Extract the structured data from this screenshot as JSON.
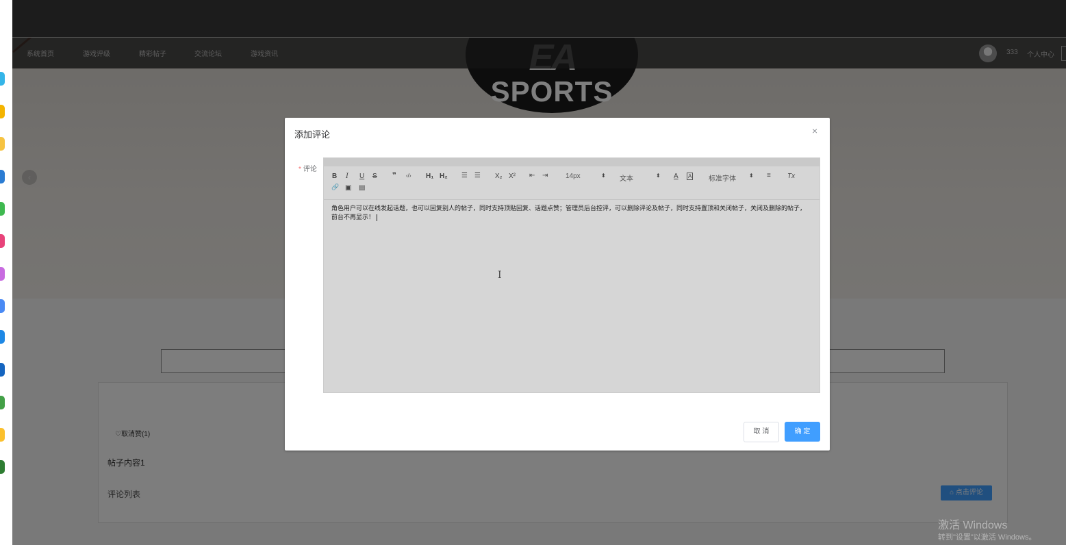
{
  "nav": {
    "items": [
      {
        "label": "系统首页"
      },
      {
        "label": "游戏评级"
      },
      {
        "label": "精彩帖子"
      },
      {
        "label": "交流论坛"
      },
      {
        "label": "游戏资讯"
      }
    ],
    "username": "333",
    "user_center": "个人中心"
  },
  "hero": {
    "logo_ea": "EA",
    "logo_sports": "SPORTS",
    "arrow": "‹"
  },
  "post": {
    "like_label": "♡取消赞(1)",
    "content": "帖子内容1",
    "comment_list_title": "评论列表",
    "comment_button": "⌂ 点击评论"
  },
  "dialog": {
    "title": "添加评论",
    "close": "×",
    "field_label": "评论",
    "required_mark": "*",
    "editor": {
      "toolbar": {
        "bold": "B",
        "italic": "I",
        "underline": "U",
        "strike": "S",
        "quote": "❞",
        "code": "‹/›",
        "h1": "H₁",
        "h2": "H₂",
        "ordered_list": "☰",
        "bullet_list": "☰",
        "subscript": "X₂",
        "superscript": "X²",
        "indent_left": "⇤",
        "indent_right": "⇥",
        "size": "14px",
        "header": "文本",
        "font_color": "A",
        "background_color": "A",
        "font": "标准字体",
        "align": "≡",
        "clean": "Tx",
        "link": "🔗",
        "image": "▣",
        "video": "▤",
        "select_arrow": "⬍"
      },
      "content": "角色用户可以在线发起话题，也可以回复别人的帖子，同时支持顶贴回复、话题点赞；管理员后台控评，可以删除评论及帖子，同时支持置顶和关闭帖子，关闭及删除的帖子，前台不再显示！"
    },
    "cancel": "取 消",
    "confirm": "确 定"
  },
  "watermark": {
    "line1": "激活 Windows",
    "line2": "转到\"设置\"以激活 Windows。"
  },
  "colors": {
    "primary": "#409eff",
    "required": "#f56c6c",
    "topbar": "#1c1c1c"
  }
}
